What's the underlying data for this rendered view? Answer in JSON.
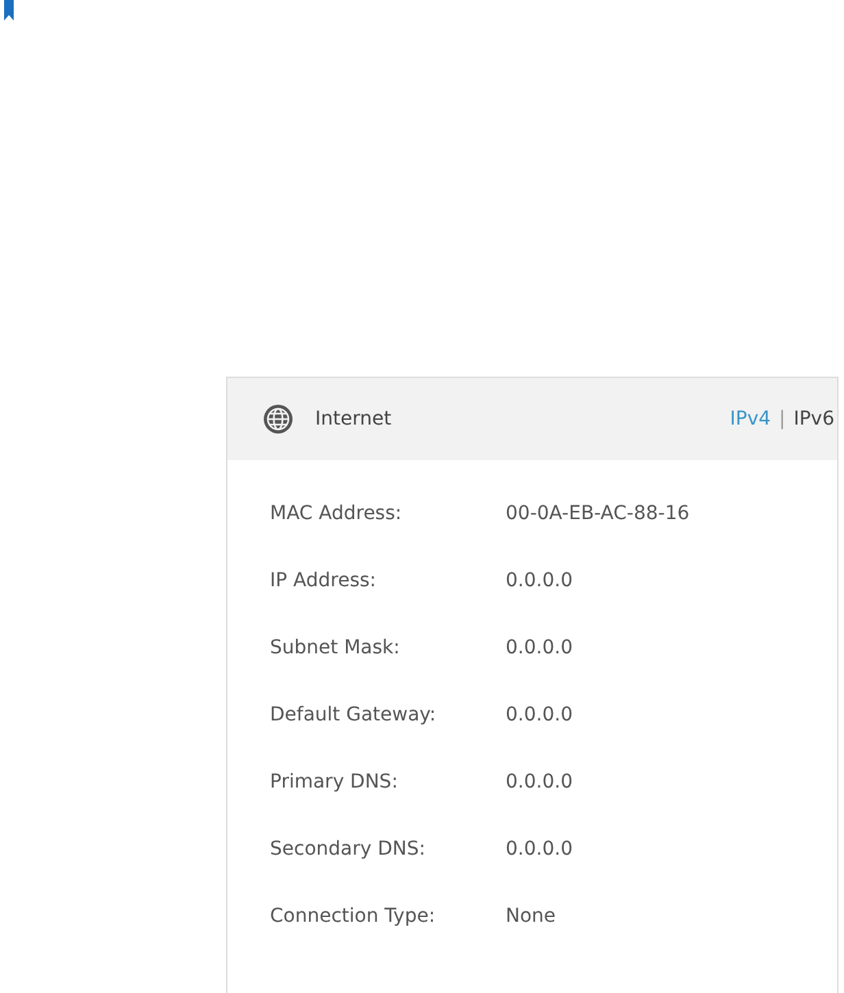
{
  "panel": {
    "title": "Internet",
    "tabs": [
      {
        "label": "IPv4",
        "selected": true
      },
      {
        "label": "IPv6",
        "selected": false
      }
    ],
    "separator": "|",
    "fields": [
      {
        "label": "MAC Address:",
        "value": "00-0A-EB-AC-88-16"
      },
      {
        "label": "IP Address:",
        "value": "0.0.0.0"
      },
      {
        "label": "Subnet Mask:",
        "value": "0.0.0.0"
      },
      {
        "label": "Default Gateway:",
        "value": "0.0.0.0"
      },
      {
        "label": "Primary DNS:",
        "value": "0.0.0.0"
      },
      {
        "label": "Secondary DNS:",
        "value": "0.0.0.0"
      },
      {
        "label": "Connection Type:",
        "value": "None"
      }
    ]
  }
}
